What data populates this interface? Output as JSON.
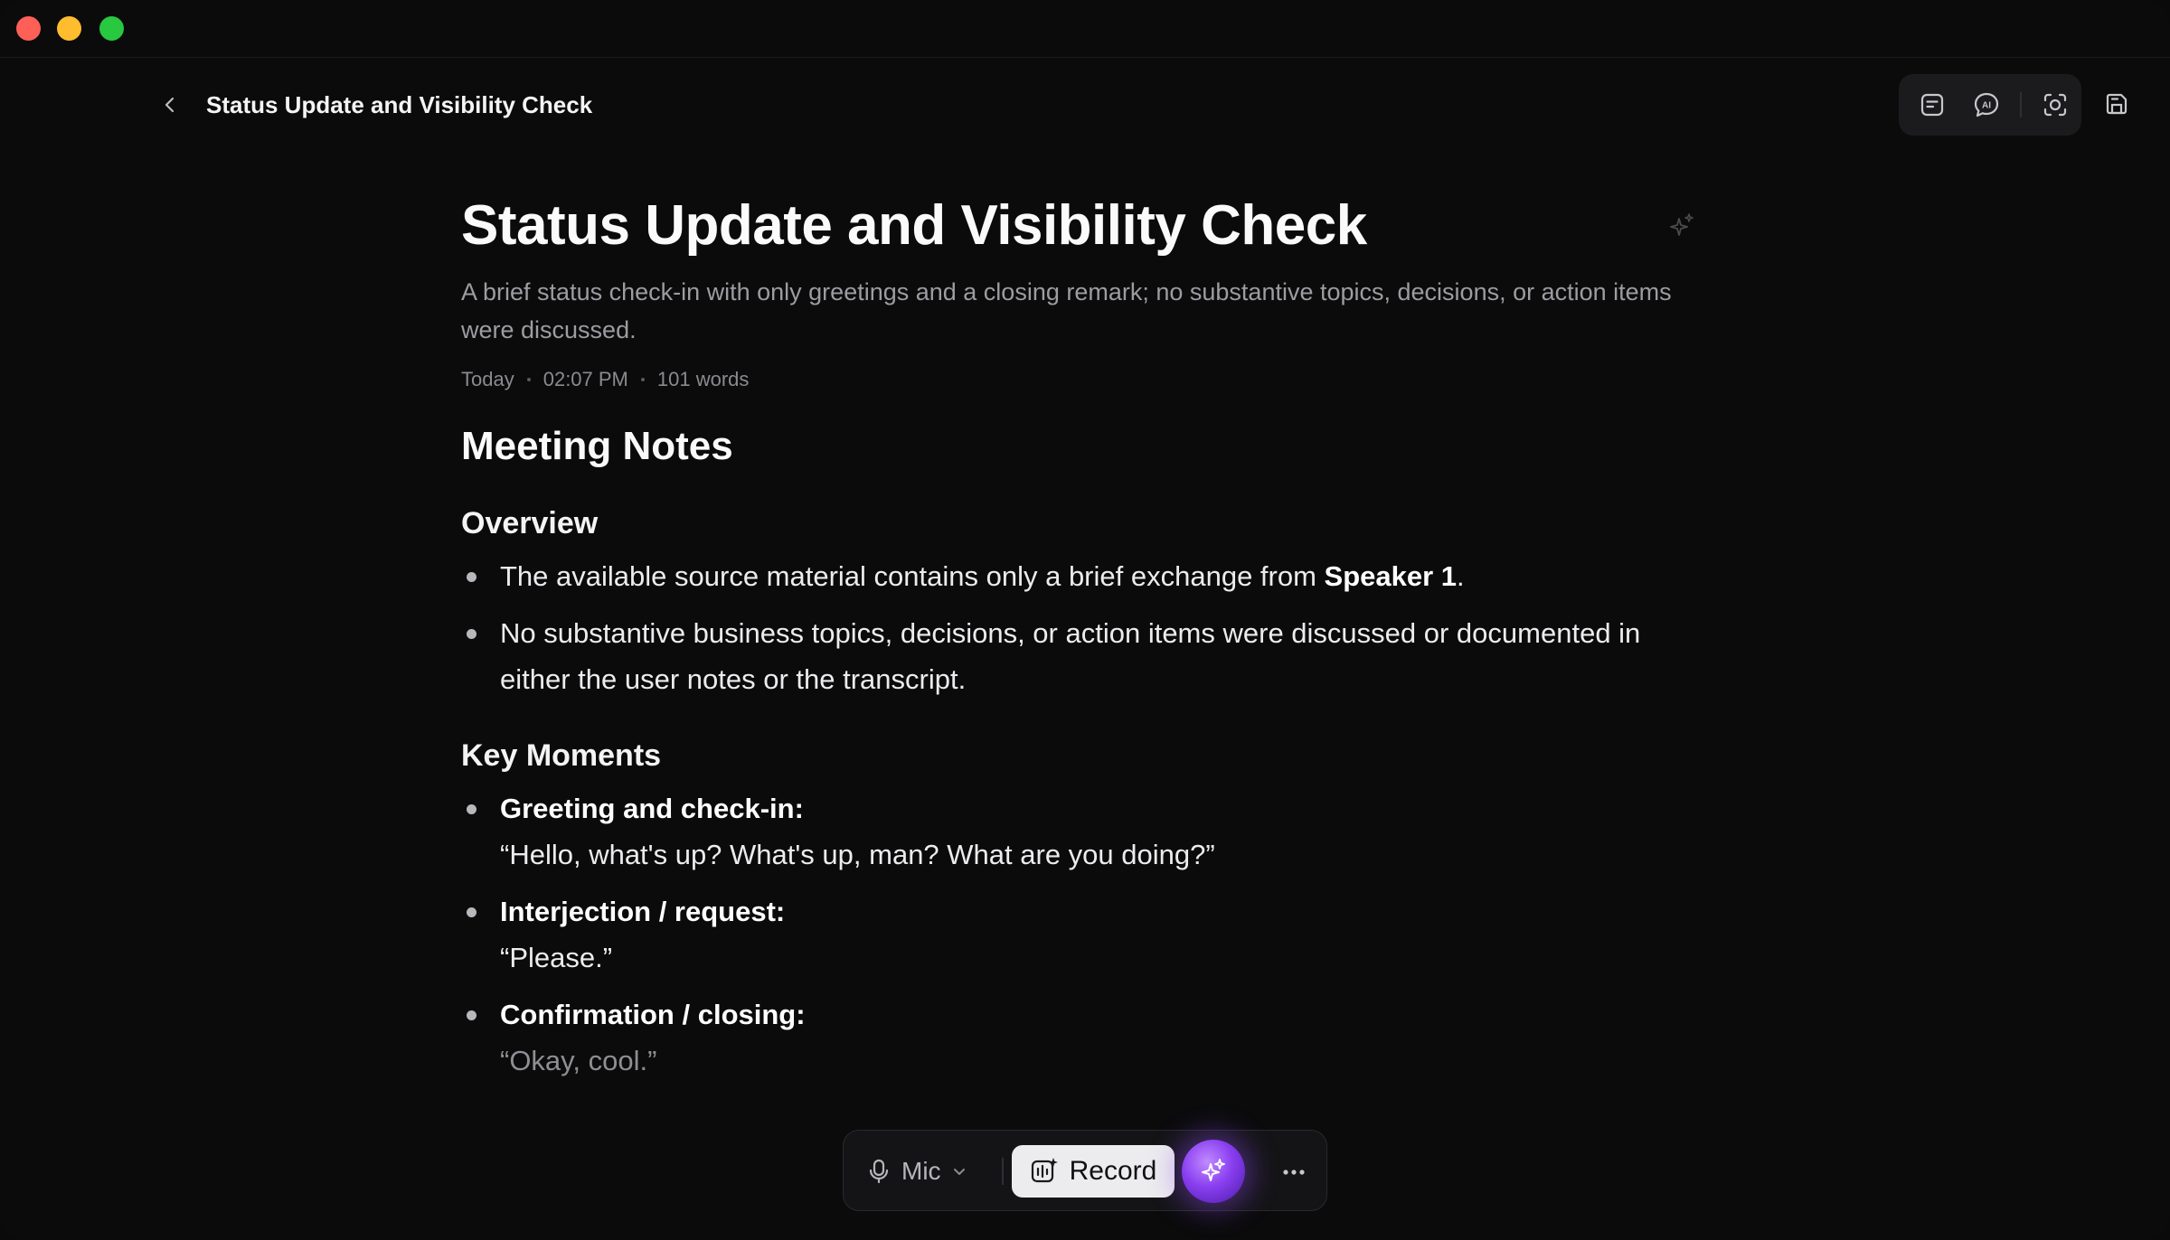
{
  "header": {
    "title": "Status Update and Visibility Check"
  },
  "toolbar": {
    "icons": [
      "notes-icon",
      "ai-chat-icon",
      "screenshot-icon",
      "save-icon"
    ]
  },
  "document": {
    "title": "Status Update and Visibility Check",
    "summary": "A brief status check-in with only greetings and a closing remark; no substantive topics, decisions, or action items were discussed.",
    "meta": {
      "date": "Today",
      "time": "02:07 PM",
      "words": "101 words"
    },
    "heading": "Meeting Notes",
    "overview": {
      "heading": "Overview",
      "item1_pre": "The available source material contains only a brief exchange from ",
      "item1_bold": "Speaker 1",
      "item1_post": ".",
      "item2": "No substantive business topics, decisions, or action items were discussed or documented in either the user notes or the transcript."
    },
    "key_moments": {
      "heading": "Key Moments",
      "items": [
        {
          "label": "Greeting and check-in:",
          "quote": "“Hello, what's up? What's up, man? What are you doing?”"
        },
        {
          "label": "Interjection / request:",
          "quote": "“Please.”"
        },
        {
          "label": "Confirmation / closing:",
          "quote": "“Okay, cool.”"
        }
      ]
    }
  },
  "controls": {
    "mic_label": "Mic",
    "record_label": "Record"
  }
}
